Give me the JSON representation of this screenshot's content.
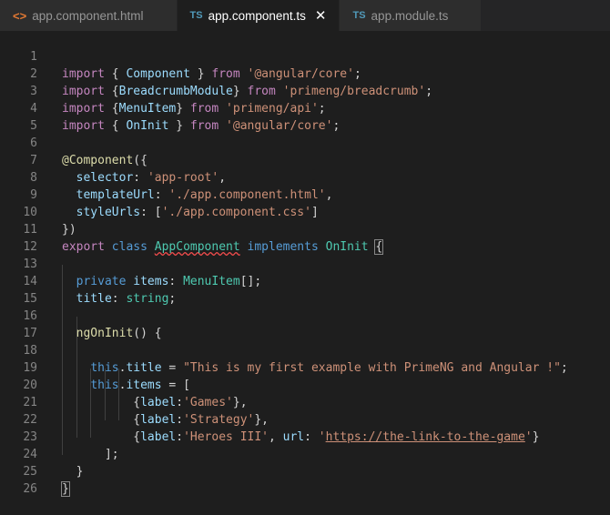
{
  "tabs": [
    {
      "icon": "<>",
      "label": "app.component.html",
      "active": false
    },
    {
      "icon": "TS",
      "label": "app.component.ts",
      "active": true,
      "close": "✕"
    },
    {
      "icon": "TS",
      "label": "app.module.ts",
      "active": false
    }
  ],
  "line_numbers": [
    "1",
    "2",
    "3",
    "4",
    "5",
    "6",
    "7",
    "8",
    "9",
    "10",
    "11",
    "12",
    "13",
    "14",
    "15",
    "16",
    "17",
    "18",
    "19",
    "20",
    "21",
    "22",
    "23",
    "24",
    "25",
    "26"
  ],
  "code": {
    "l1": {
      "kw": "import",
      "p1": " { ",
      "t": "Component",
      "p2": " } ",
      "from": "from",
      "sp": " ",
      "str": "'@angular/core'",
      "end": ";"
    },
    "l2": {
      "kw": "import",
      "p1": " {",
      "t": "BreadcrumbModule",
      "p2": "} ",
      "from": "from",
      "sp": " ",
      "str": "'primeng/breadcrumb'",
      "end": ";"
    },
    "l3": {
      "kw": "import",
      "p1": " {",
      "t": "MenuItem",
      "p2": "} ",
      "from": "from",
      "sp": " ",
      "str": "'primeng/api'",
      "end": ";"
    },
    "l4": {
      "kw": "import",
      "p1": " { ",
      "t": "OnInit",
      "p2": " } ",
      "from": "from",
      "sp": " ",
      "str": "'@angular/core'",
      "end": ";"
    },
    "l6": {
      "at": "@",
      "deco": "Component",
      "p": "({"
    },
    "l7": {
      "prop": "selector",
      "c": ": ",
      "str": "'app-root'",
      "end": ","
    },
    "l8": {
      "prop": "templateUrl",
      "c": ": ",
      "str": "'./app.component.html'",
      "end": ","
    },
    "l9": {
      "prop": "styleUrls",
      "c": ": [",
      "str": "'./app.component.css'",
      "end": "]"
    },
    "l10": {
      "p": "})"
    },
    "l11": {
      "kw1": "export",
      "kw2": "class",
      "cls": "AppComponent",
      "kw3": "implements",
      "iface": "OnInit",
      "brace": "{"
    },
    "l13": {
      "kw": "private",
      "prop": "items",
      "c": ": ",
      "t": "MenuItem",
      "end": "[];"
    },
    "l14": {
      "prop": "title",
      "c": ": ",
      "t": "string",
      "end": ";"
    },
    "l16": {
      "fn": "ngOnInit",
      "p": "() {"
    },
    "l18": {
      "kw": "this",
      "dot": ".",
      "prop": "title",
      "eq": " = ",
      "str": "\"This is my first example with PrimeNG and Angular !\"",
      "end": ";"
    },
    "l19": {
      "kw": "this",
      "dot": ".",
      "prop": "items",
      "eq": " = ["
    },
    "l20": {
      "p1": "{",
      "prop": "label",
      "c": ":",
      "str": "'Games'",
      "end": "},"
    },
    "l21": {
      "p1": "{",
      "prop": "label",
      "c": ":",
      "str": "'Strategy'",
      "end": "},"
    },
    "l22": {
      "p1": "{",
      "prop": "label",
      "c": ":",
      "str": "'Heroes III'",
      "sep": ", ",
      "prop2": "url",
      "c2": ": ",
      "q1": "'",
      "url": "https://the-link-to-the-game",
      "q2": "'",
      "end": "}"
    },
    "l23": {
      "p": "];"
    },
    "l24": {
      "p": "}"
    },
    "l25": {
      "p": "}"
    }
  },
  "colors": {
    "background": "#1e1e1e",
    "keyword": "#569cd6",
    "control_keyword": "#c586c0",
    "string": "#ce9178",
    "property": "#9cdcfe",
    "type": "#4ec9b0",
    "function": "#dcdcaa"
  }
}
